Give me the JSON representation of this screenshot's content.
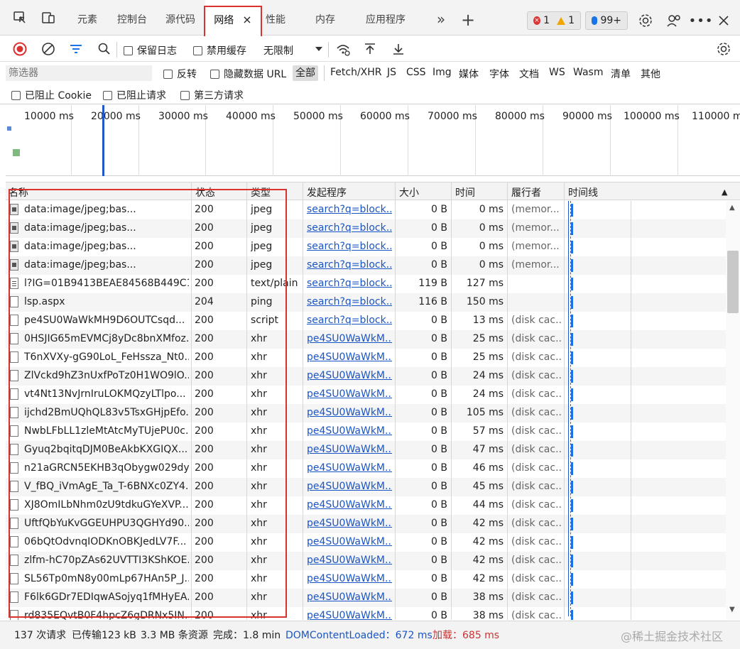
{
  "tabs": {
    "items": [
      {
        "label": "元素"
      },
      {
        "label": "控制台"
      },
      {
        "label": "源代码"
      },
      {
        "label": "网络"
      },
      {
        "label": "性能"
      },
      {
        "label": "内存"
      },
      {
        "label": "应用程序"
      }
    ],
    "close_glyph": "×",
    "more_glyph": "»",
    "add_glyph": "+"
  },
  "badges": {
    "errors": "1",
    "warnings": "1",
    "issues": "99+"
  },
  "toolbar": {
    "preserve_log": "保留日志",
    "disable_cache": "禁用缓存",
    "throttle": "无限制"
  },
  "filter": {
    "placeholder": "筛选器",
    "invert": "反转",
    "hide_data_url": "隐藏数据 URL",
    "types": [
      "全部",
      "Fetch/XHR",
      "JS",
      "CSS",
      "Img",
      "媒体",
      "字体",
      "文档",
      "WS",
      "Wasm",
      "清单",
      "其他"
    ],
    "blocked_cookies": "已阻止 Cookie",
    "blocked_requests": "已阻止请求",
    "third_party": "第三方请求"
  },
  "overview": {
    "ticks": [
      "10000 ms",
      "20000 ms",
      "30000 ms",
      "40000 ms",
      "50000 ms",
      "60000 ms",
      "70000 ms",
      "80000 ms",
      "90000 ms",
      "100000 ms",
      "110000 m"
    ]
  },
  "columns": {
    "name": "名称",
    "status": "状态",
    "type": "类型",
    "initiator": "发起程序",
    "size": "大小",
    "time": "时间",
    "fulfilled": "履行者",
    "waterfall": "时间线",
    "sort_glyph": "▲"
  },
  "rows": [
    {
      "name": "data:image/jpeg;bas...",
      "status": "200",
      "type": "jpeg",
      "initiator": "search?q=block...",
      "size": "0 B",
      "time": "0 ms",
      "fulfilled": "(memor...",
      "icon": "img"
    },
    {
      "name": "data:image/jpeg;bas...",
      "status": "200",
      "type": "jpeg",
      "initiator": "search?q=block...",
      "size": "0 B",
      "time": "0 ms",
      "fulfilled": "(memor...",
      "icon": "img"
    },
    {
      "name": "data:image/jpeg;bas...",
      "status": "200",
      "type": "jpeg",
      "initiator": "search?q=block...",
      "size": "0 B",
      "time": "0 ms",
      "fulfilled": "(memor...",
      "icon": "img"
    },
    {
      "name": "data:image/jpeg;bas...",
      "status": "200",
      "type": "jpeg",
      "initiator": "search?q=block...",
      "size": "0 B",
      "time": "0 ms",
      "fulfilled": "(memor...",
      "icon": "img"
    },
    {
      "name": "l?IG=01B9413BEAE84568B449C1...",
      "status": "200",
      "type": "text/plain",
      "initiator": "search?q=block...",
      "size": "119 B",
      "time": "127 ms",
      "fulfilled": "",
      "icon": "txt"
    },
    {
      "name": "lsp.aspx",
      "status": "204",
      "type": "ping",
      "initiator": "search?q=block...",
      "size": "116 B",
      "time": "150 ms",
      "fulfilled": "",
      "icon": "file"
    },
    {
      "name": "pe4SU0WaWkMH9D6OUTCsqd...",
      "status": "200",
      "type": "script",
      "initiator": "search?q=block...",
      "size": "0 B",
      "time": "13 ms",
      "fulfilled": "(disk cac...",
      "icon": "file"
    },
    {
      "name": "0HSJIG65mEVMCj8yDc8bnXMfoz...",
      "status": "200",
      "type": "xhr",
      "initiator": "pe4SU0WaWkM...",
      "size": "0 B",
      "time": "25 ms",
      "fulfilled": "(disk cac...",
      "icon": "file"
    },
    {
      "name": "T6nXVXy-gG90LoL_FeHssza_Nt0...",
      "status": "200",
      "type": "xhr",
      "initiator": "pe4SU0WaWkM...",
      "size": "0 B",
      "time": "25 ms",
      "fulfilled": "(disk cac...",
      "icon": "file"
    },
    {
      "name": "ZlVckd9hZ3nUxfPoTz0H1WO9lO...",
      "status": "200",
      "type": "xhr",
      "initiator": "pe4SU0WaWkM...",
      "size": "0 B",
      "time": "24 ms",
      "fulfilled": "(disk cac...",
      "icon": "file"
    },
    {
      "name": "vt4Nt13NvJrnIruLOKMQzyLTlpo...",
      "status": "200",
      "type": "xhr",
      "initiator": "pe4SU0WaWkM...",
      "size": "0 B",
      "time": "24 ms",
      "fulfilled": "(disk cac...",
      "icon": "file"
    },
    {
      "name": "ijchd2BmUQhQL83v5TsxGHjpEfo...",
      "status": "200",
      "type": "xhr",
      "initiator": "pe4SU0WaWkM...",
      "size": "0 B",
      "time": "105 ms",
      "fulfilled": "(disk cac...",
      "icon": "file"
    },
    {
      "name": "NwbLFbLL1zleMtAtcMyTUjePU0c...",
      "status": "200",
      "type": "xhr",
      "initiator": "pe4SU0WaWkM...",
      "size": "0 B",
      "time": "57 ms",
      "fulfilled": "(disk cac...",
      "icon": "file"
    },
    {
      "name": "Gyuq2bqitqDJM0BeAkbKXGIQX...",
      "status": "200",
      "type": "xhr",
      "initiator": "pe4SU0WaWkM...",
      "size": "0 B",
      "time": "47 ms",
      "fulfilled": "(disk cac...",
      "icon": "file"
    },
    {
      "name": "n21aGRCN5EKHB3qObygw029dy...",
      "status": "200",
      "type": "xhr",
      "initiator": "pe4SU0WaWkM...",
      "size": "0 B",
      "time": "46 ms",
      "fulfilled": "(disk cac...",
      "icon": "file"
    },
    {
      "name": "V_fBQ_iVmAgE_Ta_T-6BNXc0ZY4...",
      "status": "200",
      "type": "xhr",
      "initiator": "pe4SU0WaWkM...",
      "size": "0 B",
      "time": "45 ms",
      "fulfilled": "(disk cac...",
      "icon": "file"
    },
    {
      "name": "XJ8OmILbNhm0zU9tdkuGYeXVP...",
      "status": "200",
      "type": "xhr",
      "initiator": "pe4SU0WaWkM...",
      "size": "0 B",
      "time": "44 ms",
      "fulfilled": "(disk cac...",
      "icon": "file"
    },
    {
      "name": "UftfQbYuKvGGEUHPU3QGHYd90...",
      "status": "200",
      "type": "xhr",
      "initiator": "pe4SU0WaWkM...",
      "size": "0 B",
      "time": "42 ms",
      "fulfilled": "(disk cac...",
      "icon": "file"
    },
    {
      "name": "06bQtOdvnqIODKnOBKJedLV7F...",
      "status": "200",
      "type": "xhr",
      "initiator": "pe4SU0WaWkM...",
      "size": "0 B",
      "time": "42 ms",
      "fulfilled": "(disk cac...",
      "icon": "file"
    },
    {
      "name": "zlfm-hC70pZAs62UVTTI3KShKOE...",
      "status": "200",
      "type": "xhr",
      "initiator": "pe4SU0WaWkM...",
      "size": "0 B",
      "time": "42 ms",
      "fulfilled": "(disk cac...",
      "icon": "file"
    },
    {
      "name": "SL56Tp0mN8y00mLp67HAn5P_J...",
      "status": "200",
      "type": "xhr",
      "initiator": "pe4SU0WaWkM...",
      "size": "0 B",
      "time": "42 ms",
      "fulfilled": "(disk cac...",
      "icon": "file"
    },
    {
      "name": "F6lk6GDr7EDIqwASojyq1fMHyEA...",
      "status": "200",
      "type": "xhr",
      "initiator": "pe4SU0WaWkM...",
      "size": "0 B",
      "time": "38 ms",
      "fulfilled": "(disk cac...",
      "icon": "file"
    },
    {
      "name": "rd835EQvtB0F4hpcZ6gDRNx5IN...",
      "status": "200",
      "type": "xhr",
      "initiator": "pe4SU0WaWkM...",
      "size": "0 B",
      "time": "38 ms",
      "fulfilled": "(disk cac...",
      "icon": "file"
    }
  ],
  "status": {
    "requests": "137 次请求",
    "transferred": "已传输123 kB",
    "resources": "3.3 MB 条资源",
    "finish": "完成：1.8 min",
    "dcl": "DOMContentLoaded：672 ms",
    "load": "加载：685 ms"
  },
  "watermark": "@稀土掘金技术社区",
  "colors": {
    "accent": "#1a73e8",
    "record": "#d9322f",
    "link": "#1a55c5",
    "highlight_box": "#d9322f"
  }
}
